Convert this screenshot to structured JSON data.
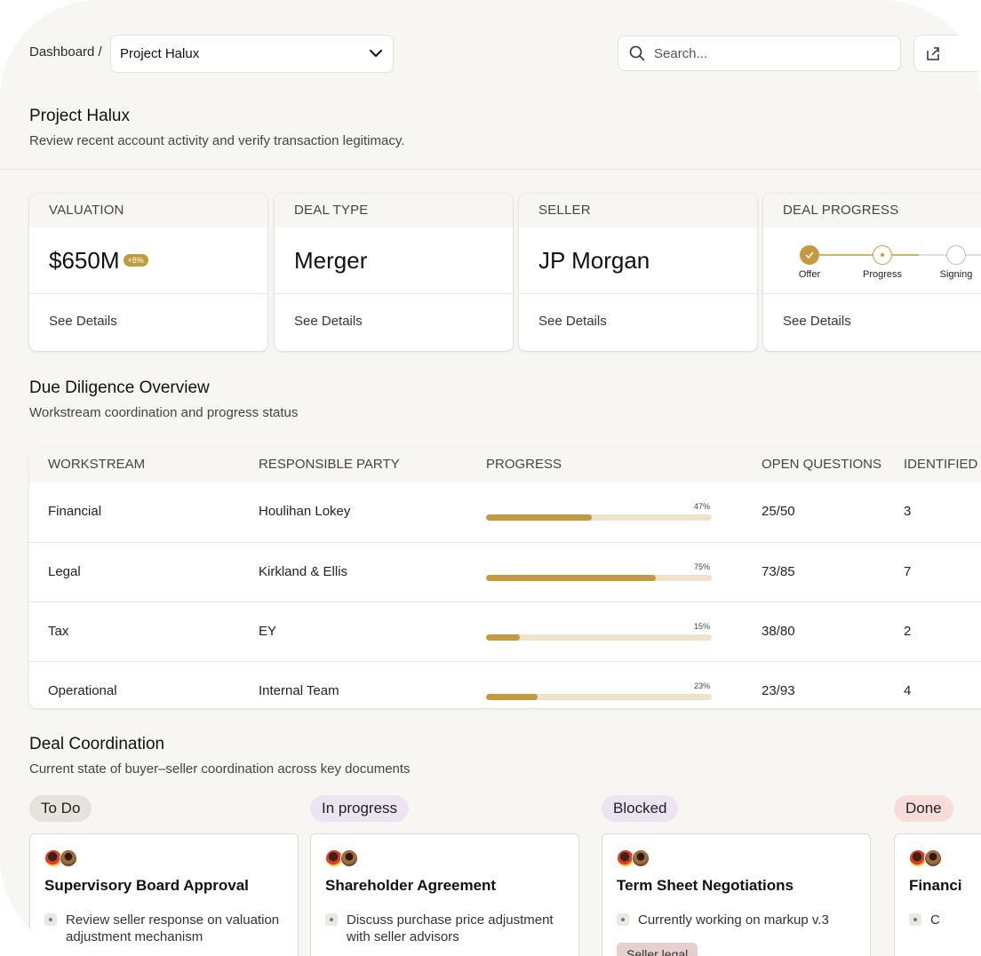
{
  "header": {
    "breadcrumb_root": "Dashboard /",
    "project_select_value": "Project Halux",
    "search_placeholder": "Search..."
  },
  "page": {
    "title": "Project Halux",
    "subtitle": "Review recent account activity and verify transaction legitimacy."
  },
  "cards": {
    "valuation": {
      "label": "VALUATION",
      "value": "$650M",
      "badge": "+8%",
      "footer": "See Details"
    },
    "deal_type": {
      "label": "DEAL TYPE",
      "value": "Merger",
      "footer": "See Details"
    },
    "seller": {
      "label": "SELLER",
      "value": "JP Morgan",
      "footer": "See Details"
    },
    "deal_progress": {
      "label": "DEAL PROGRESS",
      "steps": [
        "Offer",
        "Progress",
        "Signing"
      ],
      "current_step": 2,
      "footer": "See Details"
    }
  },
  "due_diligence": {
    "title": "Due Diligence Overview",
    "subtitle": "Workstream coordination and progress status",
    "columns": [
      "WORKSTREAM",
      "RESPONSIBLE PARTY",
      "PROGRESS",
      "OPEN QUESTIONS",
      "IDENTIFIED I"
    ],
    "rows": [
      {
        "workstream": "Financial",
        "party": "Houlihan Lokey",
        "progress": 47,
        "progress_label": "47%",
        "open": "25/50",
        "identified": "3"
      },
      {
        "workstream": "Legal",
        "party": "Kirkland & Ellis",
        "progress": 75,
        "progress_label": "75%",
        "open": "73/85",
        "identified": "7"
      },
      {
        "workstream": "Tax",
        "party": "EY",
        "progress": 15,
        "progress_label": "15%",
        "open": "38/80",
        "identified": "2"
      },
      {
        "workstream": "Operational",
        "party": "Internal Team",
        "progress": 23,
        "progress_label": "23%",
        "open": "23/93",
        "identified": "4"
      }
    ]
  },
  "coordination": {
    "title": "Deal Coordination",
    "subtitle": "Current state of buyer–seller coordination across key documents",
    "columns": [
      {
        "label": "To Do",
        "color": "#e6e3dd",
        "card": {
          "title": "Supervisory Board Approval",
          "item": "Review seller response on valuation adjustment mechanism"
        }
      },
      {
        "label": "In progress",
        "color": "#ece4f3",
        "card": {
          "title": "Shareholder Agreement",
          "item": "Discuss purchase price adjustment with seller advisors"
        }
      },
      {
        "label": "Blocked",
        "color": "#ece4f3",
        "card": {
          "title": "Term Sheet Negotiations",
          "item": "Currently working on markup v.3",
          "tag": "Seller legal"
        }
      },
      {
        "label": "Done",
        "color": "#f8dcdc",
        "card": {
          "title": "Financi",
          "item": "C"
        }
      }
    ]
  },
  "colors": {
    "accent": "#c39a3f",
    "track": "#eee3cb",
    "background": "#f8f6f2"
  }
}
